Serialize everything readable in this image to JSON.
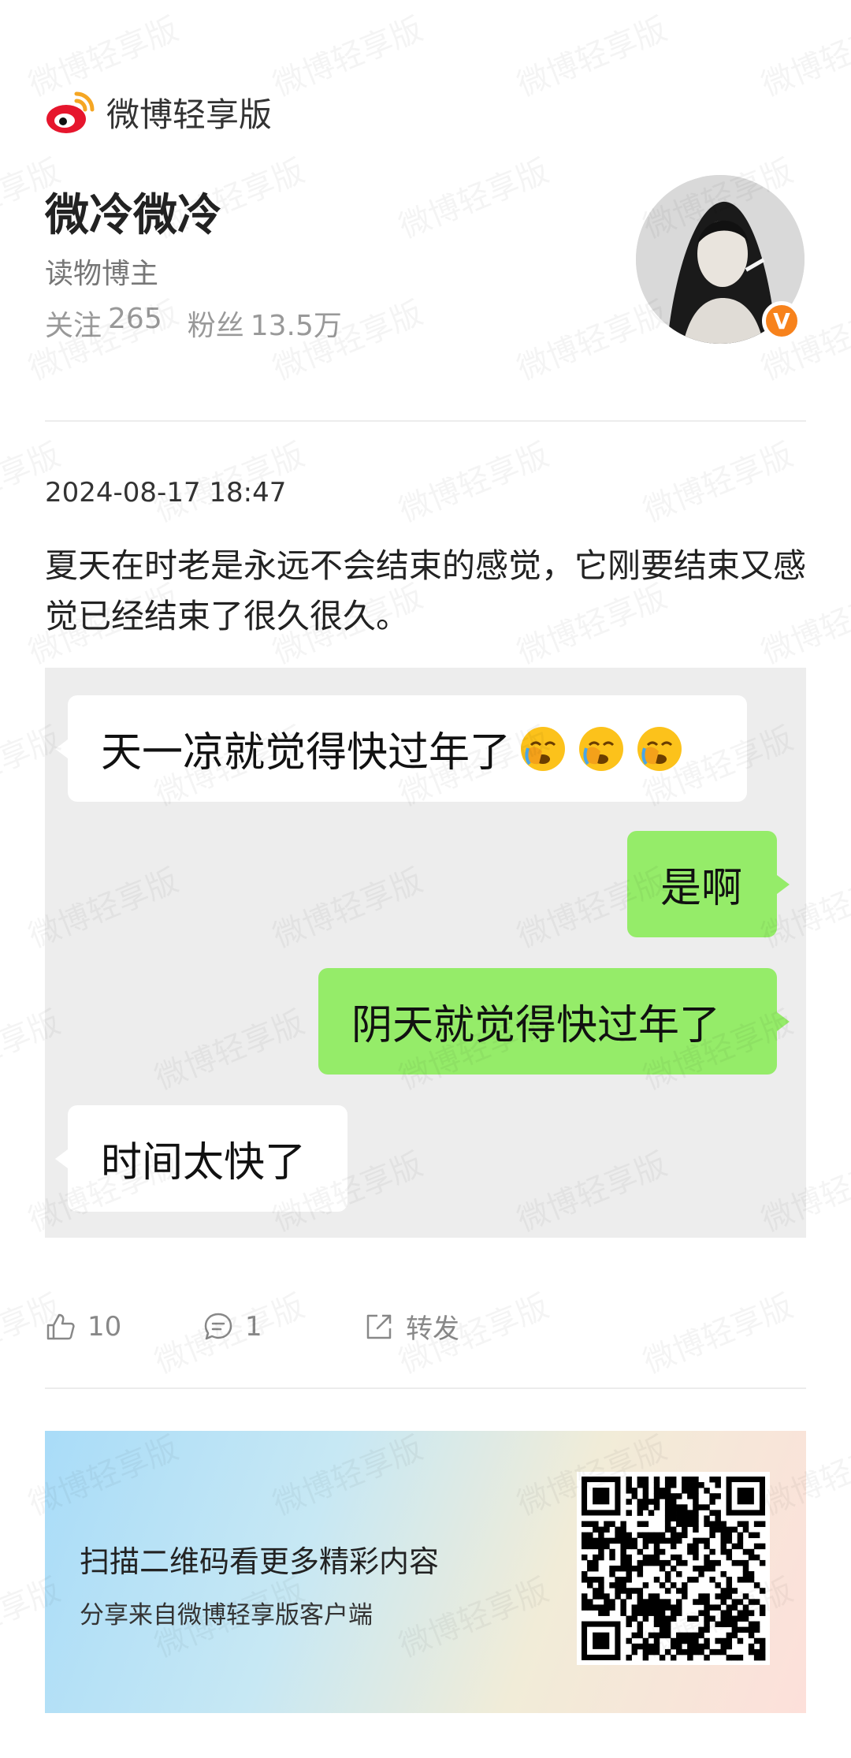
{
  "app": {
    "name": "微博轻享版",
    "watermark": "微博轻享版"
  },
  "profile": {
    "name": "微冷微冷",
    "bio": "读物博主",
    "stats": [
      {
        "label": "关注",
        "value": "265"
      },
      {
        "label": "粉丝",
        "value": "13.5万"
      }
    ],
    "verified_mark": "V"
  },
  "post": {
    "time": "2024-08-17 18:47",
    "text": "夏天在时老是永远不会结束的感觉，它刚要结束又感觉已经结束了很久很久。",
    "chat": [
      {
        "side": "left",
        "text": "天一凉就觉得快过年了",
        "emoji": "face-palm-crying-icon"
      },
      {
        "side": "right",
        "text": "是啊"
      },
      {
        "side": "right",
        "text": "阴天就觉得快过年了"
      },
      {
        "side": "left",
        "text": "时间太快了"
      }
    ]
  },
  "actions": {
    "likes": "10",
    "comments": "1",
    "repost": "转发"
  },
  "banner": {
    "title": "扫描二维码看更多精彩内容",
    "subtitle": "分享来自微博轻享版客户端"
  },
  "colors": {
    "accent": "#f7821c",
    "weibo_red": "#e6162d",
    "chat_bg": "#ededed",
    "bubble_right": "#95ec69",
    "bubble_left": "#ffffff"
  }
}
